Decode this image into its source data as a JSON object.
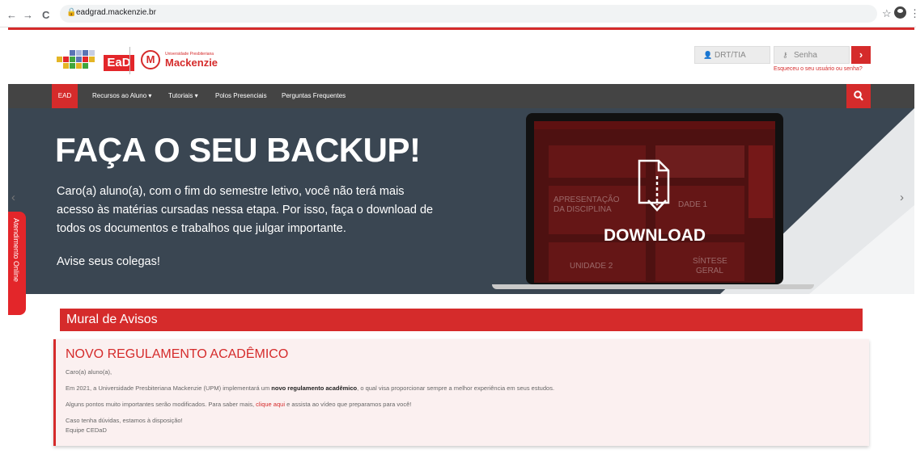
{
  "browser": {
    "back_icon": "←",
    "forward_icon": "→",
    "reload_icon": "C",
    "url": "eadgrad.mackenzie.br",
    "bookmark_icon": "☆",
    "menu_icon": "⋮"
  },
  "header": {
    "ead_logo_text": "EaD",
    "mackenzie_small": "Universidade Presbiteriana",
    "mackenzie_big": "Mackenzie",
    "mackenzie_mark": "M"
  },
  "login": {
    "user_placeholder": "DRT/TIA",
    "password_placeholder": "Senha",
    "submit_label": "›",
    "forgot_link": "Esqueceu o seu usuário ou senha?"
  },
  "nav": {
    "items": [
      {
        "label": "EAD"
      },
      {
        "label": "Recursos ao Aluno ▾"
      },
      {
        "label": "Tutoriais ▾"
      },
      {
        "label": "Polos Presenciais"
      },
      {
        "label": "Perguntas Frequentes"
      }
    ]
  },
  "hero": {
    "title": "FAÇA O SEU BACKUP!",
    "body": "Caro(a) aluno(a), com o fim do semestre letivo, você não terá mais acesso às matérias cursadas nessa etapa. Por isso, faça o download de todos os documentos e trabalhos que julgar importante.",
    "note": "Avise seus colegas!",
    "download_label": "DOWNLOAD",
    "ghost_1": "APRESENTAÇÃO",
    "ghost_2": "DA DISCIPLINA",
    "ghost_3": "DADE 1",
    "ghost_4": "UNIDADE 2",
    "ghost_5": "SÍNTESE",
    "ghost_6": "GERAL",
    "prev_icon": "‹",
    "next_icon": "›"
  },
  "atendimento": {
    "label": "Atendimento Online"
  },
  "mural": {
    "title": "Mural de Avisos",
    "aviso": {
      "title": "NOVO REGULAMENTO ACADÊMICO",
      "greeting": "Caro(a) aluno(a),",
      "line1_pre": "Em 2021, a Universidade Presbiteriana Mackenzie (UPM) implementará um ",
      "line1_bold": "novo regulamento acadêmico",
      "line1_post": ", o qual visa proporcionar sempre a melhor experiência em seus estudos.",
      "line2_pre": "Alguns pontos muito importantes serão modificados. Para saber mais, ",
      "line2_link": "clique aqui",
      "line2_post": " e assista ao vídeo que preparamos para você!",
      "line3": "Caso tenha dúvidas, estamos à disposição!",
      "signature": "Equipe CEDaD"
    }
  },
  "colors": {
    "brand_red": "#d52b2b",
    "nav_dark": "#444444",
    "hero_bg": "#3a4652"
  }
}
